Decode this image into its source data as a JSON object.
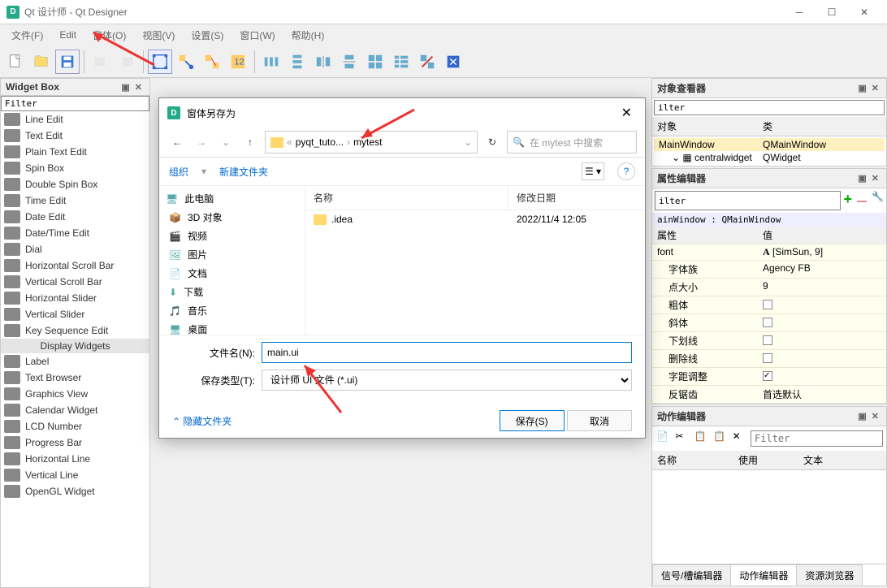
{
  "window": {
    "title": "Qt 设计师 - Qt Designer"
  },
  "menu": [
    "文件(F)",
    "Edit",
    "窗体(O)",
    "视图(V)",
    "设置(S)",
    "窗口(W)",
    "帮助(H)"
  ],
  "widgetbox": {
    "title": "Widget Box",
    "filter": "Filter",
    "items": [
      "Line Edit",
      "Text Edit",
      "Plain Text Edit",
      "Spin Box",
      "Double Spin Box",
      "Time Edit",
      "Date Edit",
      "Date/Time Edit",
      "Dial",
      "Horizontal Scroll Bar",
      "Vertical Scroll Bar",
      "Horizontal Slider",
      "Vertical Slider",
      "Key Sequence Edit"
    ],
    "group": "Display Widgets",
    "items2": [
      "Label",
      "Text Browser",
      "Graphics View",
      "Calendar Widget",
      "LCD Number",
      "Progress Bar",
      "Horizontal Line",
      "Vertical Line",
      "OpenGL Widget"
    ]
  },
  "dialog": {
    "title": "窗体另存为",
    "path": [
      "pyqt_tuto...",
      "mytest"
    ],
    "search_ph": "在 mytest 中搜索",
    "toolbar": {
      "org": "组织",
      "new": "新建文件夹"
    },
    "side": [
      "此电脑",
      "3D 对象",
      "视频",
      "图片",
      "文档",
      "下载",
      "音乐",
      "桌面"
    ],
    "cols": {
      "name": "名称",
      "date": "修改日期"
    },
    "files": [
      {
        "name": ".idea",
        "date": "2022/11/4 12:05"
      }
    ],
    "filename_label": "文件名(N):",
    "filename": "main.ui",
    "type_label": "保存类型(T):",
    "type": "设计师 UI 文件 (*.ui)",
    "hide": "隐藏文件夹",
    "save": "保存(S)",
    "cancel": "取消"
  },
  "object_browser": {
    "title": "对象查看器",
    "cols": {
      "obj": "对象",
      "cls": "类"
    },
    "rows": [
      {
        "obj": "MainWindow",
        "cls": "QMainWindow",
        "sel": true
      },
      {
        "obj": "centralwidget",
        "cls": "QWidget",
        "indent": true
      }
    ]
  },
  "prop": {
    "title": "属性编辑器",
    "filter": "ilter",
    "breadcrumb": "ainWindow : QMainWindow",
    "cols": {
      "name": "属性",
      "val": "值"
    },
    "rows": [
      {
        "n": "font",
        "v": "[SimSun, 9]",
        "icon": "A"
      },
      {
        "n": "字体族",
        "v": "Agency FB",
        "indent": true
      },
      {
        "n": "点大小",
        "v": "9",
        "indent": true
      },
      {
        "n": "粗体",
        "v": "cb",
        "indent": true
      },
      {
        "n": "斜体",
        "v": "cb",
        "indent": true
      },
      {
        "n": "下划线",
        "v": "cb",
        "indent": true
      },
      {
        "n": "删除线",
        "v": "cb",
        "indent": true
      },
      {
        "n": "字距调整",
        "v": "cb-chk",
        "indent": true
      },
      {
        "n": "反锯齿",
        "v": "首选默认",
        "indent": true
      }
    ]
  },
  "action": {
    "title": "动作编辑器",
    "filter": "Filter",
    "cols": [
      "名称",
      "使用",
      "文本"
    ],
    "tabs": [
      "信号/槽编辑器",
      "动作编辑器",
      "资源浏览器"
    ]
  }
}
